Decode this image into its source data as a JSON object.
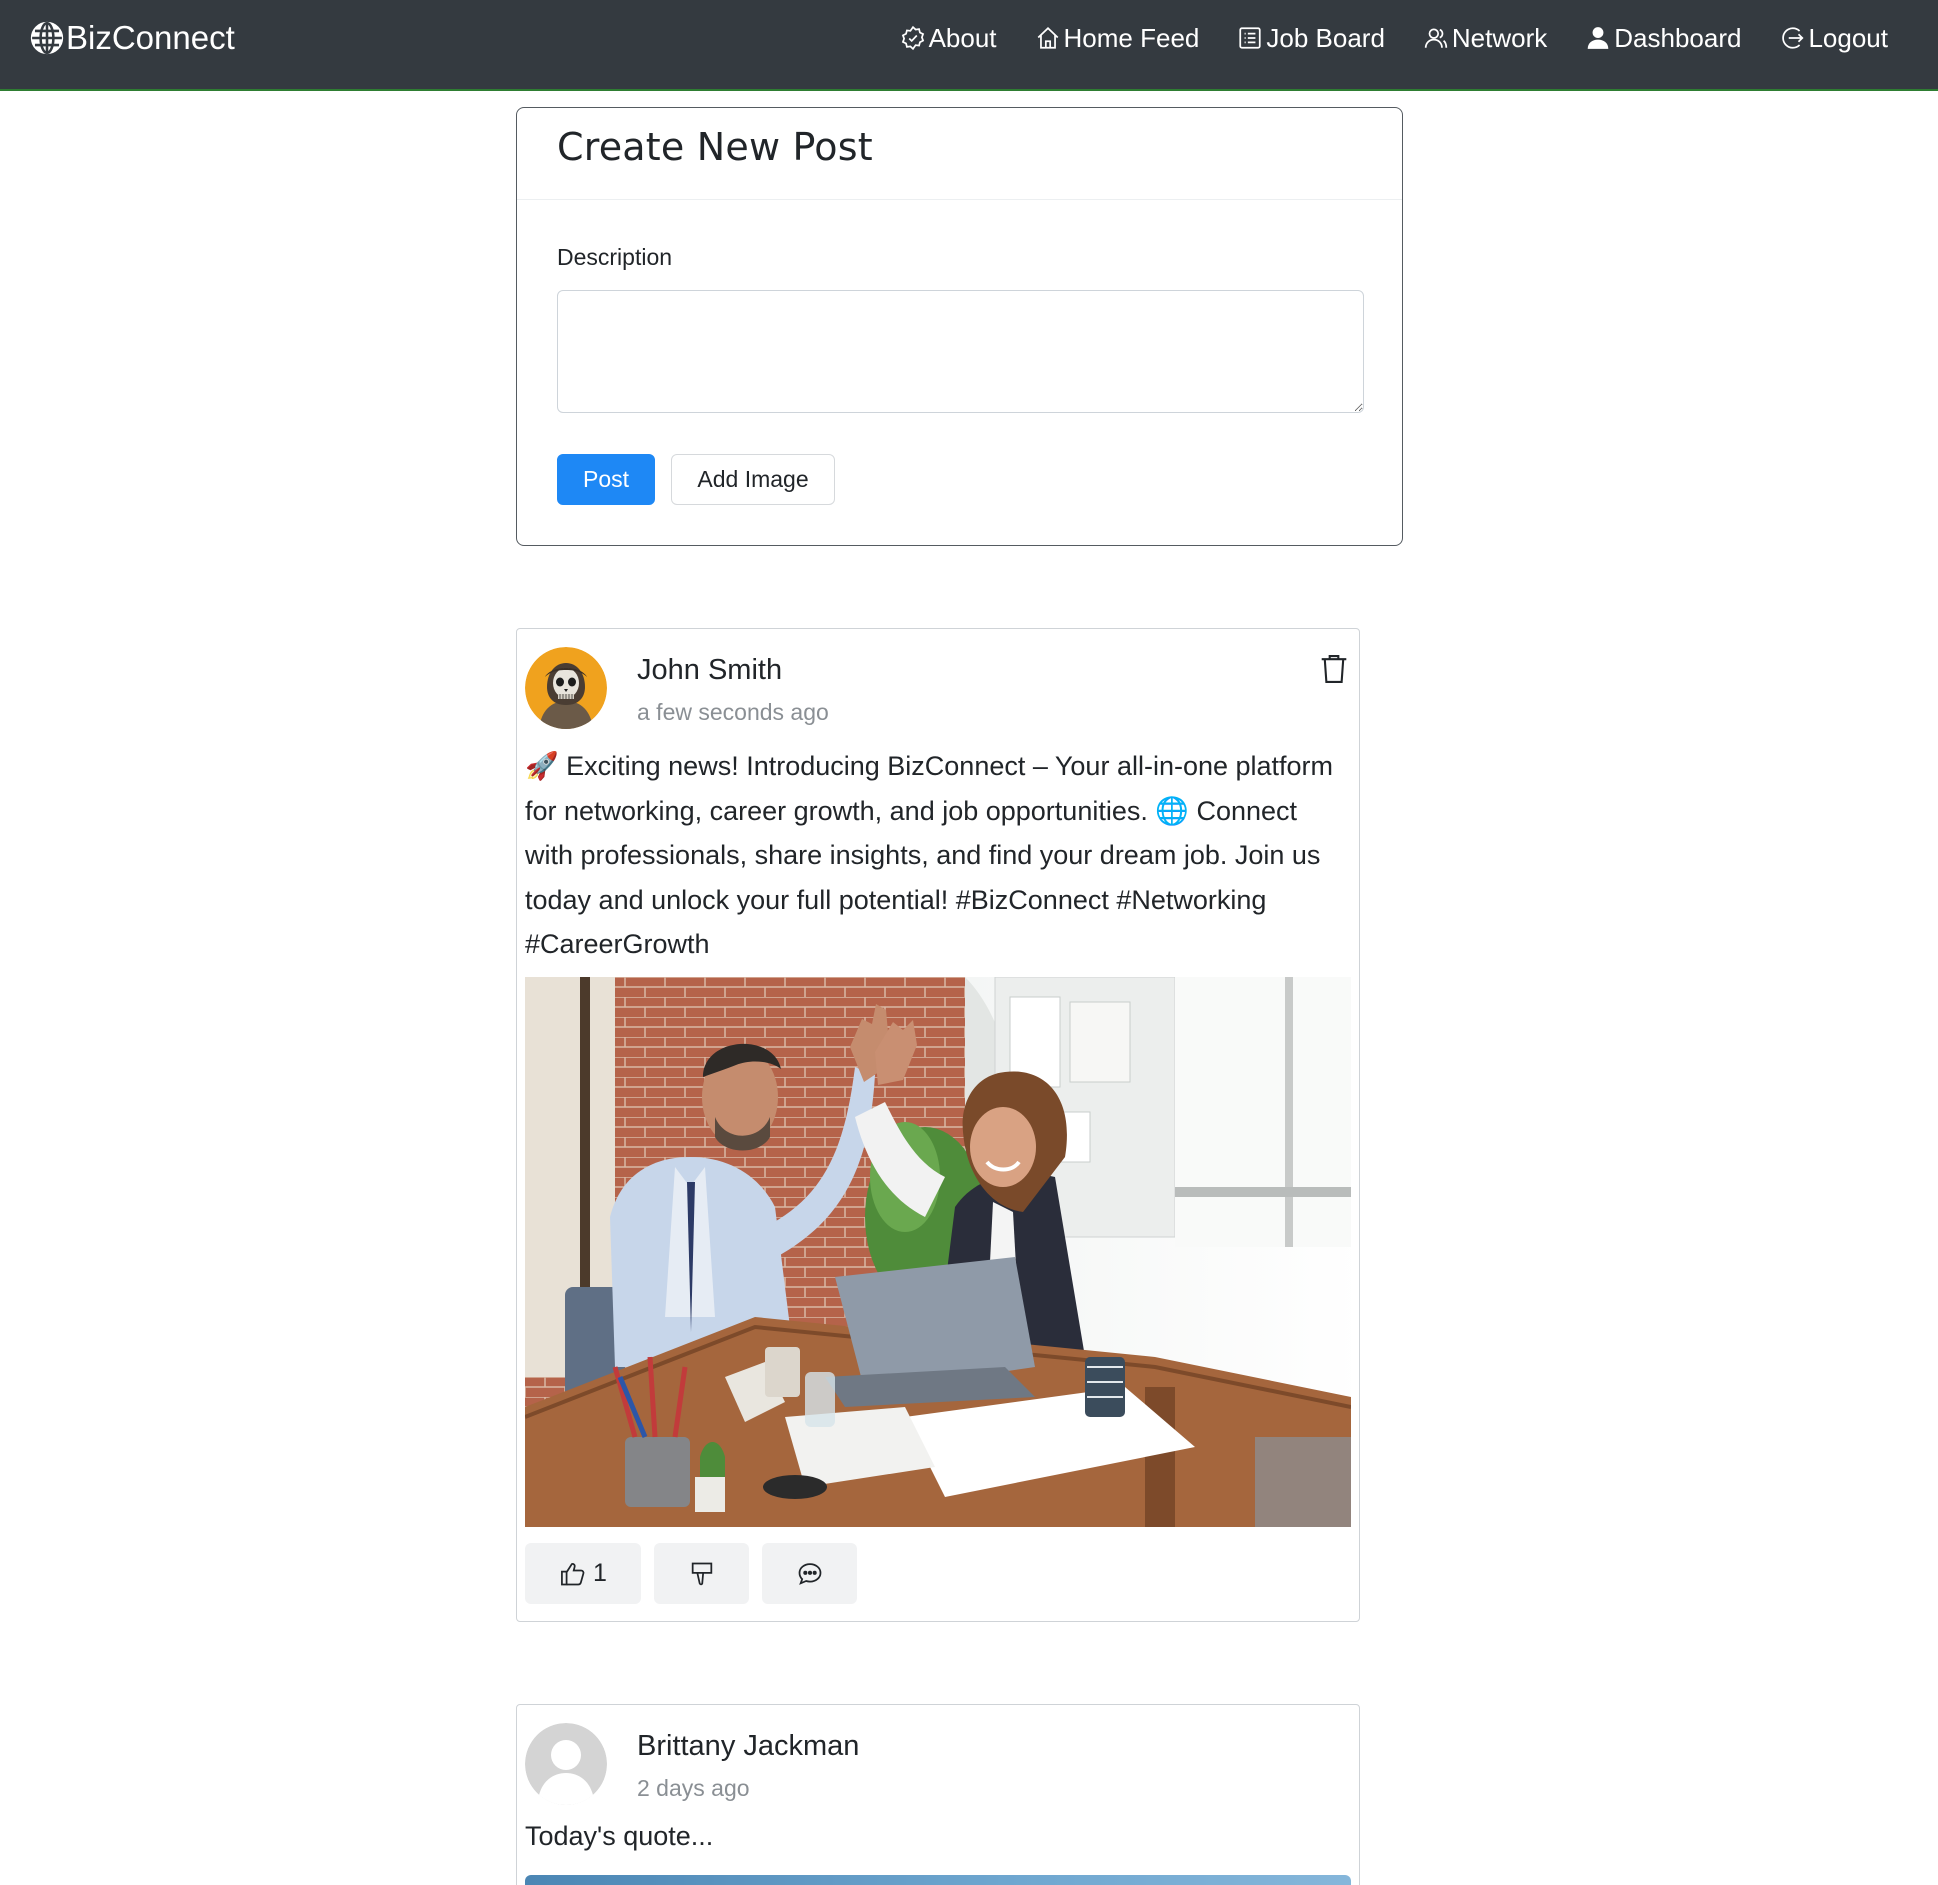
{
  "brand": {
    "name": "BizConnect",
    "icon": "globe-icon"
  },
  "nav": {
    "items": [
      {
        "label": "About",
        "icon": "badge-icon"
      },
      {
        "label": "Home Feed",
        "icon": "home-icon"
      },
      {
        "label": "Job Board",
        "icon": "list-icon"
      },
      {
        "label": "Network",
        "icon": "people-icon"
      },
      {
        "label": "Dashboard",
        "icon": "person-icon"
      },
      {
        "label": "Logout",
        "icon": "logout-icon"
      }
    ]
  },
  "create_post": {
    "title": "Create New Post",
    "description_label": "Description",
    "description_value": "",
    "post_button": "Post",
    "add_image_button": "Add Image"
  },
  "posts": [
    {
      "author": "John Smith",
      "time": "a few seconds ago",
      "text": "🚀 Exciting news! Introducing BizConnect – Your all-in-one platform for networking, career growth, and job opportunities. 🌐 Connect with professionals, share insights, and find your dream job. Join us today and unlock your full potential! #BizConnect #Networking #CareerGrowth",
      "likes": "1",
      "icons": {
        "delete": "trash-icon",
        "like": "thumbs-up-icon",
        "dislike": "thumbs-down-icon",
        "comment": "comment-icon"
      }
    },
    {
      "author": "Brittany Jackman",
      "time": "2 days ago",
      "text": "Today's quote..."
    }
  ],
  "colors": {
    "navbar": "#343a40",
    "primary": "#1e88f5",
    "muted": "#8a8f94"
  }
}
